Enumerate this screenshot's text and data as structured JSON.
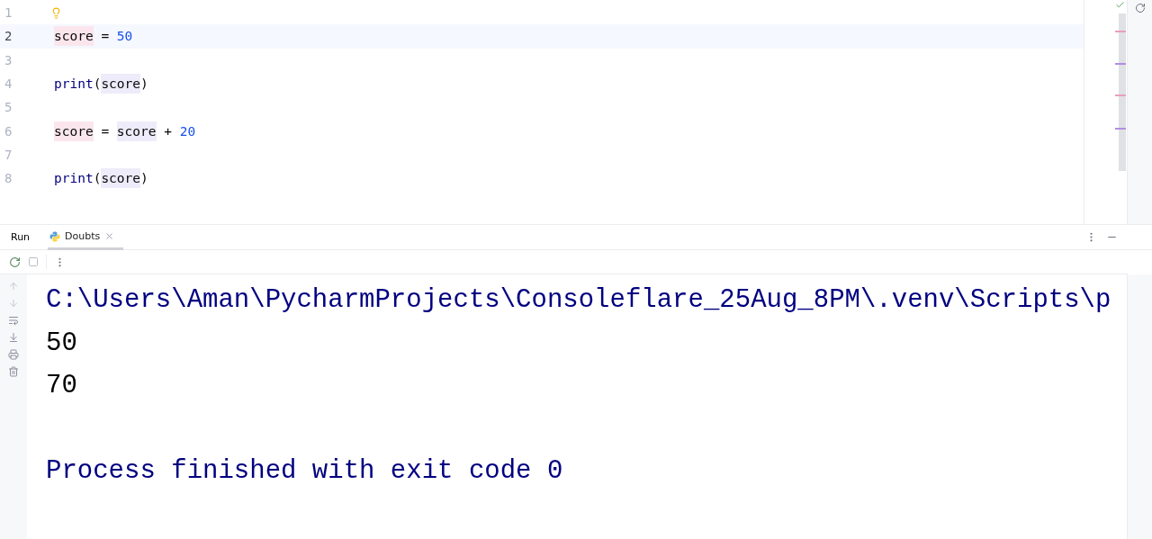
{
  "editor": {
    "lines": [
      {
        "number": "1",
        "current": false,
        "hint": true
      },
      {
        "number": "2",
        "current": true,
        "hint": false,
        "tokens": [
          {
            "text": "score",
            "kind": "write"
          },
          {
            "text": " = ",
            "kind": "plain"
          },
          {
            "text": "50",
            "kind": "number"
          }
        ]
      },
      {
        "number": "3",
        "current": false,
        "hint": false
      },
      {
        "number": "4",
        "current": false,
        "hint": false,
        "tokens": [
          {
            "text": "print",
            "kind": "builtin"
          },
          {
            "text": "(",
            "kind": "plain"
          },
          {
            "text": "score",
            "kind": "read"
          },
          {
            "text": ")",
            "kind": "plain"
          }
        ]
      },
      {
        "number": "5",
        "current": false,
        "hint": false
      },
      {
        "number": "6",
        "current": false,
        "hint": false,
        "tokens": [
          {
            "text": "score",
            "kind": "write"
          },
          {
            "text": " = ",
            "kind": "plain"
          },
          {
            "text": "score",
            "kind": "read"
          },
          {
            "text": " + ",
            "kind": "plain"
          },
          {
            "text": "20",
            "kind": "number"
          }
        ]
      },
      {
        "number": "7",
        "current": false,
        "hint": false
      },
      {
        "number": "8",
        "current": false,
        "hint": false,
        "tokens": [
          {
            "text": "print",
            "kind": "builtin"
          },
          {
            "text": "(",
            "kind": "plain"
          },
          {
            "text": "score",
            "kind": "read"
          },
          {
            "text": ")",
            "kind": "plain"
          }
        ]
      }
    ]
  },
  "run_panel": {
    "title": "Run",
    "tabs": [
      {
        "label": "Doubts",
        "selected": true
      }
    ],
    "output": [
      {
        "text": "C:\\Users\\Aman\\PycharmProjects\\Consoleflare_25Aug_8PM\\.venv\\Scripts\\p",
        "kind": "system"
      },
      {
        "text": "50",
        "kind": "stdout"
      },
      {
        "text": "70",
        "kind": "stdout"
      },
      {
        "kind": "blank"
      },
      {
        "text": "Process finished with exit code 0",
        "kind": "system"
      }
    ]
  }
}
